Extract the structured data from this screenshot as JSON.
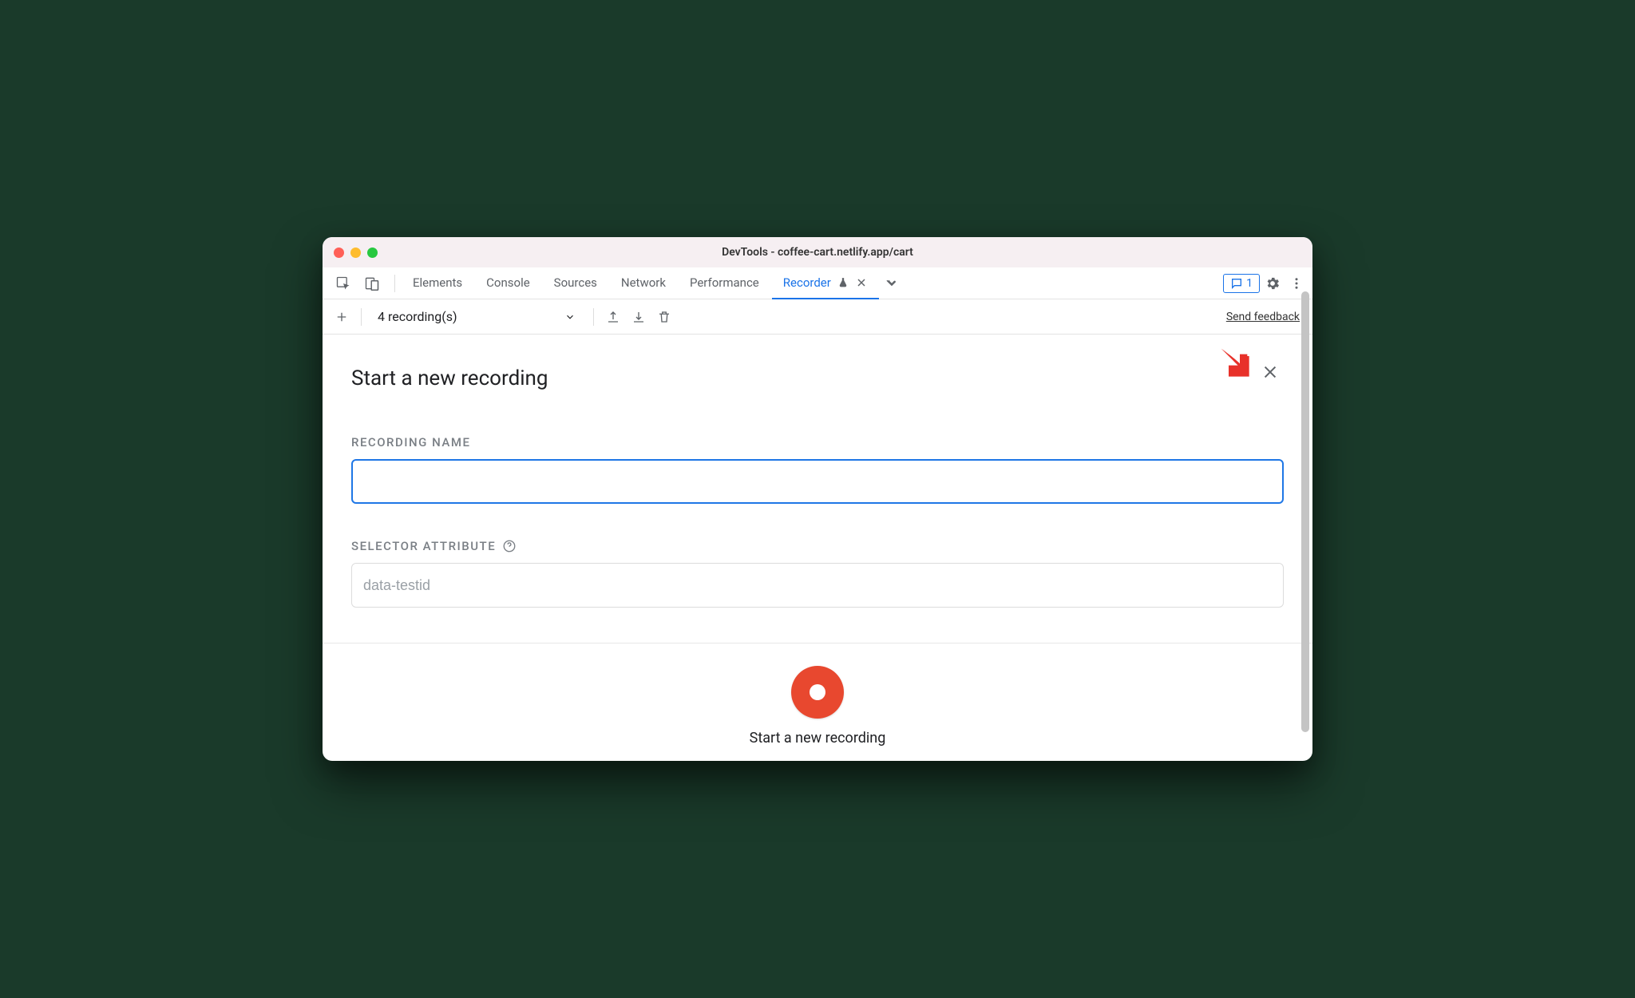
{
  "window": {
    "title": "DevTools - coffee-cart.netlify.app/cart"
  },
  "tabs": {
    "items": [
      "Elements",
      "Console",
      "Sources",
      "Network",
      "Performance",
      "Recorder"
    ],
    "active": "Recorder",
    "feedback_count": "1"
  },
  "toolbar": {
    "recordings_label": "4 recording(s)",
    "send_feedback": "Send feedback"
  },
  "panel": {
    "heading": "Start a new recording",
    "recording_name_label": "RECORDING NAME",
    "recording_name_value": "",
    "selector_attribute_label": "SELECTOR ATTRIBUTE",
    "selector_attribute_value": "",
    "selector_attribute_placeholder": "data-testid",
    "start_label": "Start a new recording"
  }
}
